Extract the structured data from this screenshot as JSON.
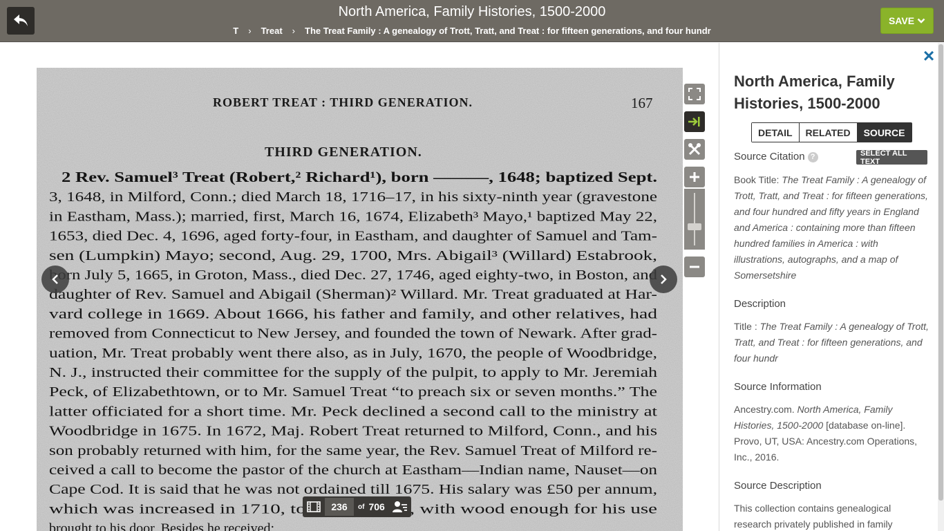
{
  "header": {
    "title": "North America, Family Histories, 1500-2000",
    "breadcrumb": [
      "T",
      "Treat",
      "The Treat Family : A genealogy of Trott, Tratt, and Treat : for fifteen generations, and four hundr"
    ],
    "save_label": "SAVE"
  },
  "document": {
    "running_head": "ROBERT TREAT : THIRD GENERATION.",
    "page_number_printed": "167",
    "section_heading": "THIRD GENERATION.",
    "lines": [
      "2  Rev. Samuel³ Treat (Robert,² Richard¹), born ———, 1648; baptized Sept.",
      "3, 1648, in Milford, Conn.; died March 18, 1716–17, in his sixty-ninth year (gravestone",
      "in Eastham, Mass.); married, first, March 16, 1674, Elizabeth³ Mayo,¹ baptized May 22,",
      "1653, died Dec. 4, 1696, aged forty-four, in Eastham, and daughter of Samuel and Tam-",
      "sen (Lumpkin) Mayo; second, Aug. 29, 1700, Mrs. Abigail³ (Willard) Estabrook,",
      "born July 5, 1665, in Groton, Mass., died Dec. 27, 1746, aged eighty-two, in Boston, and",
      "daughter of Rev. Samuel and Abigail (Sherman)² Willard.  Mr. Treat graduated at Har-",
      "vard college in 1669.  About 1666, his father and family, and other relatives, had",
      "removed from Connecticut to New Jersey, and founded the town of Newark.  After grad-",
      "uation, Mr. Treat probably went there also, as in July, 1670, the people of Woodbridge,",
      "N. J., instructed their committee for the supply of the pulpit, to apply to Mr. Jeremiah",
      "Peck, of Elizabethtown, or to Mr. Samuel Treat “to preach six or seven months.”  The",
      "latter officiated for a short time.  Mr. Peck declined a second call to the ministry at",
      "Woodbridge in 1675.  In 1672, Maj. Robert Treat returned to Milford, Conn., and his",
      "son probably returned with him, for the same year, the Rev. Samuel Treat of Milford re-",
      "ceived a call to become the pastor of the church at Eastham—Indian name, Nauset—on",
      "Cape Cod.  It is said that he was not ordained till 1675.  His salary was £50 per annum,",
      "which was increased in 1710, to £7    in money, with wood enough for his use",
      "brought to his door.  Besides he received:"
    ]
  },
  "pager": {
    "current": "236",
    "of_label": "of",
    "total": "706"
  },
  "panel": {
    "title": "North America, Family Histories, 1500-2000",
    "tabs": [
      "DETAIL",
      "RELATED",
      "SOURCE"
    ],
    "active_tab": "SOURCE",
    "source_citation_label": "Source Citation",
    "help_glyph": "?",
    "select_all_label": "SELECT ALL TEXT",
    "book_title_label": "Book Title:",
    "book_title": "The Treat Family : A genealogy of Trott, Tratt, and Treat : for fifteen generations, and four hundred and fifty years in England and America : containing more than fifteen hundred families in America : with illustrations, autographs, and a map of Somersetshire",
    "description_label": "Description",
    "title_label": "Title :",
    "title_value": "The Treat Family : A genealogy of Trott, Tratt, and Treat : for fifteen generations, and four hundr",
    "source_info_label": "Source Information",
    "source_info_prefix": "Ancestry.com.",
    "source_info_italic": "North America, Family Histories, 1500-2000",
    "source_info_suffix": "[database on-line]. Provo, UT, USA: Ancestry.com Operations, Inc., 2016.",
    "source_desc_label": "Source Description",
    "source_desc": "This collection contains genealogical research privately published in family"
  },
  "colors": {
    "header_bg": "#6e6a63",
    "save_green": "#8ab32a",
    "close_blue": "#1b6fa6",
    "active_tool": "#2e2c29",
    "tool_grey": "#8b8985",
    "tool_icon_active": "#9ccb3b"
  },
  "icons": {
    "back": "back-arrow-icon",
    "save_caret": "chevron-down-icon",
    "fullscreen": "fullscreen-icon",
    "panel_toggle": "panel-toggle-icon",
    "tools": "tools-icon",
    "zoom_in": "plus-icon",
    "zoom_out": "minus-icon",
    "prev": "chevron-left-icon",
    "next": "chevron-right-icon",
    "filmstrip": "filmstrip-icon",
    "index": "person-index-icon",
    "close": "close-icon"
  }
}
